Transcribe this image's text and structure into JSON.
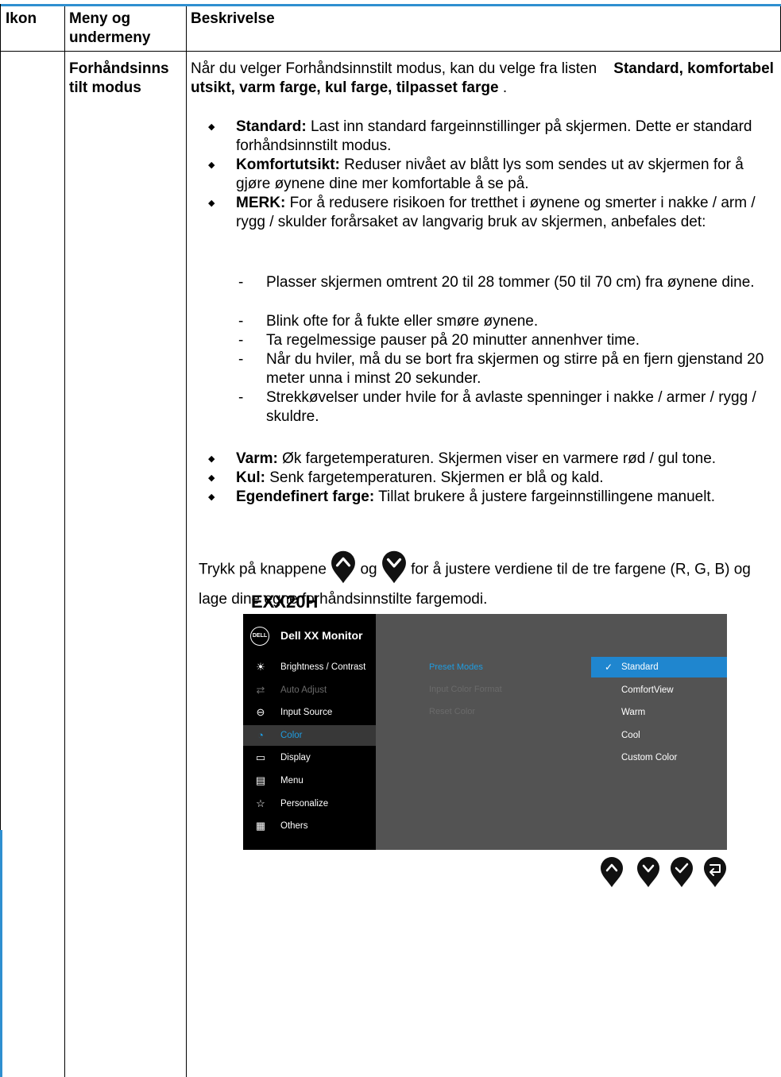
{
  "table": {
    "headers": {
      "icon": "Ikon",
      "menu": "Meny og undermeny",
      "description": "Beskrivelse"
    },
    "row": {
      "menu_name": "Forhåndsinns tilt modus",
      "intro_plain": "Når du velger Forhåndsinnstilt modus, kan du velge fra listen",
      "intro_bold": "Standard, komfortabel utsikt, varm farge, kul farge, tilpasset farge",
      "intro_end": ".",
      "bullets_top": [
        {
          "bold": "Standard:",
          "text": "Last inn standard fargeinnstillinger på skjermen. Dette er standard forhåndsinnstilt modus."
        },
        {
          "bold": "Komfortutsikt:",
          "text": "Reduser nivået av blått lys som sendes ut av skjermen for å gjøre øynene dine mer komfortable å se på."
        },
        {
          "bold": "MERK:",
          "text": "For å redusere risikoen for tretthet i øynene og smerter i nakke / arm / rygg / skulder forårsaket av langvarig bruk av skjermen, anbefales det:"
        }
      ],
      "dash_marker": "-",
      "dashes": [
        "Plasser skjermen omtrent 20 til 28 tommer (50 til 70 cm) fra øynene dine.",
        "Blink ofte for å fukte eller smøre øynene.",
        "Ta regelmessige pauser på 20 minutter annenhver time.",
        "Når du hviler, må du se bort fra skjermen og stirre på en fjern gjenstand 20 meter unna i minst 20 sekunder.",
        "Strekkøvelser under hvile for å avlaste spenninger i nakke / armer / rygg / skuldre."
      ],
      "bullets_bottom": [
        {
          "bold": "Varm:",
          "text": "Øk fargetemperaturen. Skjermen viser en varmere rød / gul tone."
        },
        {
          "bold": "Kul:",
          "text": "Senk fargetemperaturen. Skjermen er blå og kald."
        },
        {
          "bold": "Egendefinert farge:",
          "text": "Tillat brukere å justere fargeinnstillingene manuelt."
        }
      ],
      "press_before": "Trykk på knappene",
      "press_og": "og",
      "press_after": "for å justere verdiene til de tre fargene (R, G, B) og lage dine egne forhåndsinnstilte fargemodi.",
      "model": "EXX20H"
    }
  },
  "osd": {
    "logo": "DELL",
    "title": "Dell XX Monitor",
    "menu": [
      {
        "icon": "brightness-icon",
        "glyph": "☀",
        "label": "Brightness / Contrast",
        "state": "normal"
      },
      {
        "icon": "auto-adjust-icon",
        "glyph": "⇄",
        "label": "Auto Adjust",
        "state": "dim"
      },
      {
        "icon": "input-source-icon",
        "glyph": "⊖",
        "label": "Input Source",
        "state": "normal"
      },
      {
        "icon": "color-icon",
        "glyph": "◔",
        "label": "Color",
        "state": "selected"
      },
      {
        "icon": "display-icon",
        "glyph": "▭",
        "label": "Display",
        "state": "normal"
      },
      {
        "icon": "menu-icon",
        "glyph": "▤",
        "label": "Menu",
        "state": "normal"
      },
      {
        "icon": "personalize-icon",
        "glyph": "☆",
        "label": "Personalize",
        "state": "normal"
      },
      {
        "icon": "others-icon",
        "glyph": "▦",
        "label": "Others",
        "state": "normal"
      }
    ],
    "submenu": [
      {
        "label": "Preset Modes",
        "state": "active"
      },
      {
        "label": "Input Color Format",
        "state": "dim"
      },
      {
        "label": "Reset Color",
        "state": "dim"
      }
    ],
    "options": [
      {
        "label": "Standard",
        "selected": true
      },
      {
        "label": "ComfortView",
        "selected": false
      },
      {
        "label": "Warm",
        "selected": false
      },
      {
        "label": "Cool",
        "selected": false
      },
      {
        "label": "Custom Color",
        "selected": false
      }
    ],
    "check_glyph": "✓",
    "nav_buttons": [
      "up-button",
      "down-button",
      "confirm-button",
      "back-button"
    ]
  }
}
